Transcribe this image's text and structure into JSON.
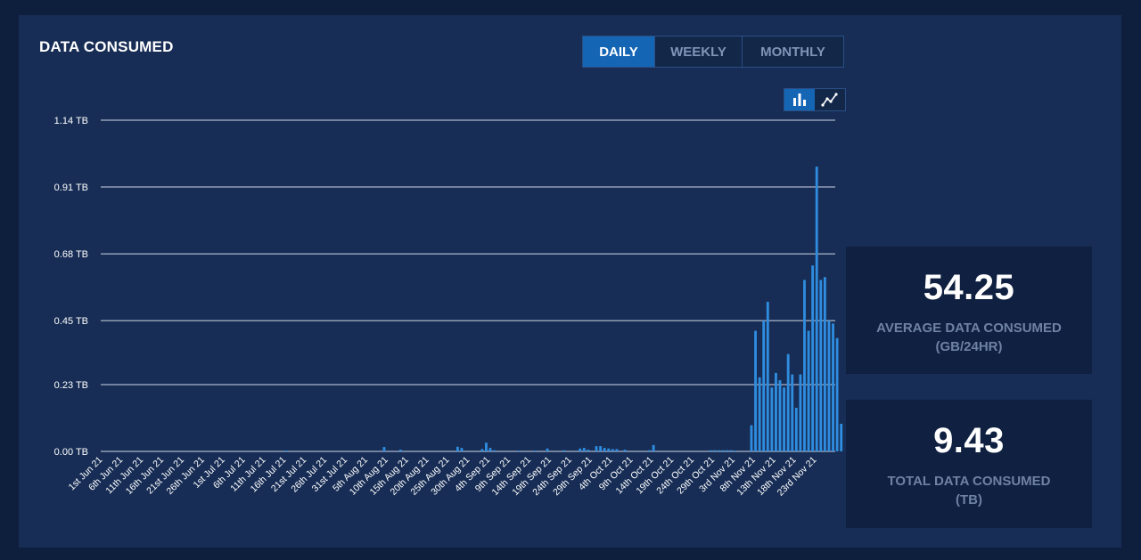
{
  "header": {
    "title": "DATA CONSUMED",
    "tabs": [
      {
        "label": "DAILY",
        "active": true
      },
      {
        "label": "WEEKLY",
        "active": false
      },
      {
        "label": "MONTHLY",
        "active": false
      }
    ]
  },
  "view_toggle": {
    "bar_icon": "bar-chart-icon",
    "line_icon": "line-chart-icon",
    "active": "bar"
  },
  "stats": {
    "average": {
      "value": "54.25",
      "label_line1": "AVERAGE DATA CONSUMED",
      "label_line2": "(GB/24HR)"
    },
    "total": {
      "value": "9.43",
      "label_line1": "TOTAL DATA CONSUMED",
      "label_line2": "(TB)"
    }
  },
  "colors": {
    "bar": "#2f8de0",
    "grid": "#cfd8e6",
    "accent": "#1565b5",
    "background": "#172d55"
  },
  "chart_data": {
    "type": "bar",
    "title": "",
    "xlabel": "",
    "ylabel": "",
    "ylim": [
      0,
      1.14
    ],
    "yticks": [
      0,
      0.23,
      0.45,
      0.68,
      0.91,
      1.14
    ],
    "ytick_labels": [
      "0.00 TB",
      "0.23 TB",
      "0.45 TB",
      "0.68 TB",
      "0.91 TB",
      "1.14 TB"
    ],
    "grid": true,
    "x_start": "2021-06-01",
    "x_end": "2021-11-27",
    "xtick_labels": [
      "1st Jun 21",
      "6th Jun 21",
      "11th Jun 21",
      "16th Jun 21",
      "21st Jun 21",
      "26th Jun 21",
      "1st Jul 21",
      "6th Jul 21",
      "11th Jul 21",
      "16th Jul 21",
      "21st Jul 21",
      "26th Jul 21",
      "31st Jul 21",
      "5th Aug 21",
      "10th Aug 21",
      "15th Aug 21",
      "20th Aug 21",
      "25th Aug 21",
      "30th Aug 21",
      "4th Sep 21",
      "9th Sep 21",
      "14th Sep 21",
      "19th Sep 21",
      "24th Sep 21",
      "29th Sep 21",
      "4th Oct 21",
      "9th Oct 21",
      "14th Oct 21",
      "19th Oct 21",
      "24th Oct 21",
      "29th Oct 21",
      "3rd Nov 21",
      "8th Nov 21",
      "13th Nov 21",
      "18th Nov 21",
      "23rd Nov 21"
    ],
    "points": [
      [
        "2021-07-16",
        0.003
      ],
      [
        "2021-08-09",
        0.015
      ],
      [
        "2021-08-13",
        0.006
      ],
      [
        "2021-08-27",
        0.016
      ],
      [
        "2021-08-28",
        0.012
      ],
      [
        "2021-09-02",
        0.008
      ],
      [
        "2021-09-03",
        0.03
      ],
      [
        "2021-09-04",
        0.012
      ],
      [
        "2021-09-05",
        0.004
      ],
      [
        "2021-09-11",
        0.003
      ],
      [
        "2021-09-15",
        0.003
      ],
      [
        "2021-09-18",
        0.01
      ],
      [
        "2021-09-22",
        0.004
      ],
      [
        "2021-09-26",
        0.01
      ],
      [
        "2021-09-27",
        0.012
      ],
      [
        "2021-09-28",
        0.006
      ],
      [
        "2021-09-30",
        0.018
      ],
      [
        "2021-10-01",
        0.018
      ],
      [
        "2021-10-02",
        0.012
      ],
      [
        "2021-10-03",
        0.01
      ],
      [
        "2021-10-04",
        0.008
      ],
      [
        "2021-10-05",
        0.008
      ],
      [
        "2021-10-07",
        0.006
      ],
      [
        "2021-10-13",
        0.004
      ],
      [
        "2021-10-14",
        0.022
      ],
      [
        "2021-10-28",
        0.004
      ],
      [
        "2021-10-29",
        0.004
      ],
      [
        "2021-10-30",
        0.004
      ],
      [
        "2021-10-31",
        0.004
      ],
      [
        "2021-11-01",
        0.004
      ],
      [
        "2021-11-02",
        0.004
      ],
      [
        "2021-11-03",
        0.003
      ],
      [
        "2021-11-07",
        0.09
      ],
      [
        "2021-11-08",
        0.415
      ],
      [
        "2021-11-09",
        0.255
      ],
      [
        "2021-11-10",
        0.45
      ],
      [
        "2021-11-11",
        0.515
      ],
      [
        "2021-11-12",
        0.22
      ],
      [
        "2021-11-13",
        0.27
      ],
      [
        "2021-11-14",
        0.245
      ],
      [
        "2021-11-15",
        0.22
      ],
      [
        "2021-11-16",
        0.335
      ],
      [
        "2021-11-17",
        0.265
      ],
      [
        "2021-11-18",
        0.15
      ],
      [
        "2021-11-19",
        0.265
      ],
      [
        "2021-11-20",
        0.59
      ],
      [
        "2021-11-21",
        0.415
      ],
      [
        "2021-11-22",
        0.64
      ],
      [
        "2021-11-23",
        0.98
      ],
      [
        "2021-11-24",
        0.59
      ],
      [
        "2021-11-25",
        0.6
      ],
      [
        "2021-11-26",
        0.45
      ],
      [
        "2021-11-27",
        0.44
      ],
      [
        "2021-11-28",
        0.39
      ],
      [
        "2021-11-29",
        0.095
      ]
    ]
  }
}
